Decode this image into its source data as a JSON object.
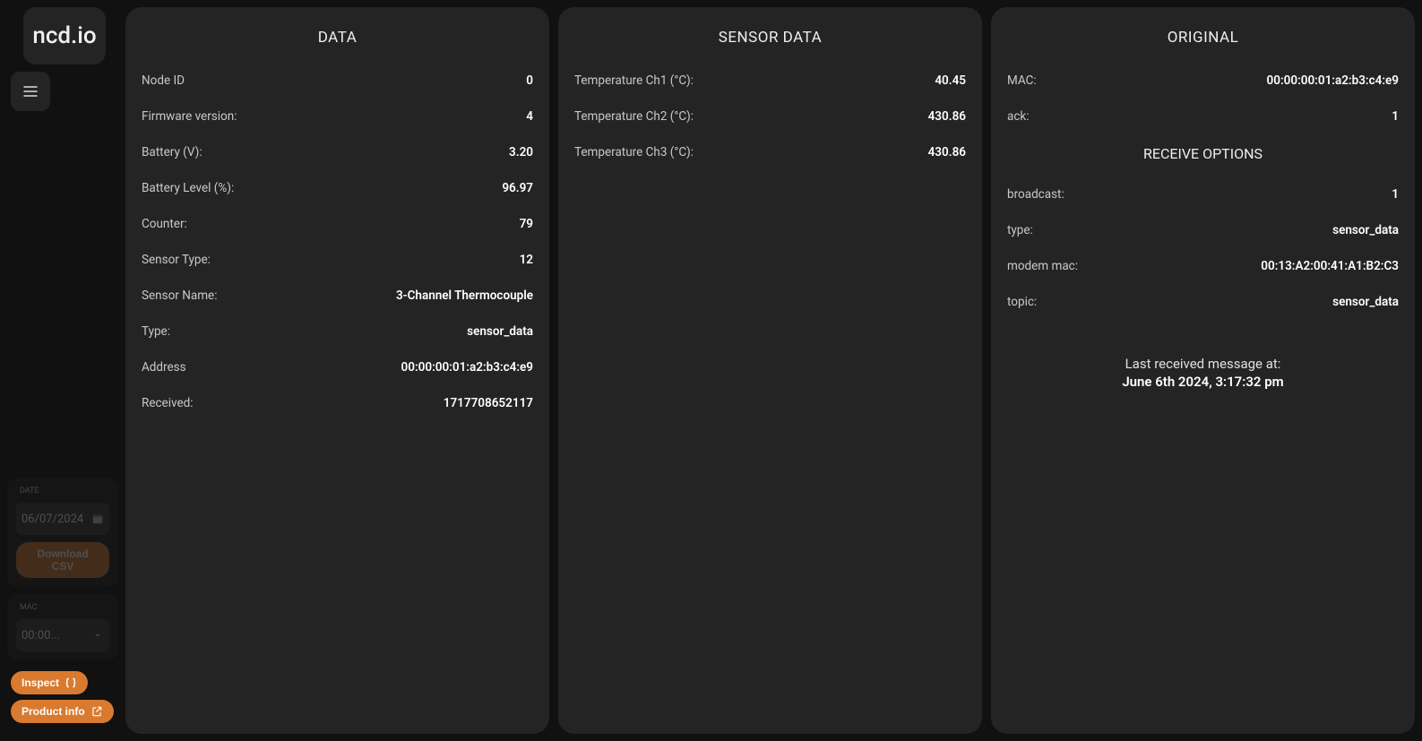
{
  "logo_text": "ncd.io",
  "sidebar": {
    "date_label": "Date",
    "date_value": "06/07/2024",
    "download_csv": "Download CSV",
    "mac_label": "MAC",
    "mac_value": "00:00...",
    "inspect_label": "Inspect",
    "product_info_label": "Product info"
  },
  "panels": {
    "data": {
      "title": "DATA",
      "rows": [
        {
          "label": "Node ID",
          "value": "0"
        },
        {
          "label": "Firmware version:",
          "value": "4"
        },
        {
          "label": "Battery (V):",
          "value": "3.20"
        },
        {
          "label": "Battery Level (%):",
          "value": "96.97"
        },
        {
          "label": "Counter:",
          "value": "79"
        },
        {
          "label": "Sensor Type:",
          "value": "12"
        },
        {
          "label": "Sensor Name:",
          "value": "3-Channel Thermocouple"
        },
        {
          "label": "Type:",
          "value": "sensor_data"
        },
        {
          "label": "Address",
          "value": "00:00:00:01:a2:b3:c4:e9"
        },
        {
          "label": "Received:",
          "value": "1717708652117"
        }
      ]
    },
    "sensor_data": {
      "title": "SENSOR DATA",
      "rows": [
        {
          "label": "Temperature Ch1 (°C):",
          "value": "40.45"
        },
        {
          "label": "Temperature Ch2 (°C):",
          "value": "430.86"
        },
        {
          "label": "Temperature Ch3 (°C):",
          "value": "430.86"
        }
      ]
    },
    "original": {
      "title": "ORIGINAL",
      "rows": [
        {
          "label": "MAC:",
          "value": "00:00:00:01:a2:b3:c4:e9"
        },
        {
          "label": "ack:",
          "value": "1"
        }
      ],
      "receive_title": "RECEIVE OPTIONS",
      "receive_rows": [
        {
          "label": "broadcast:",
          "value": "1"
        },
        {
          "label": "type:",
          "value": "sensor_data"
        },
        {
          "label": "modem mac:",
          "value": "00:13:A2:00:41:A1:B2:C3"
        },
        {
          "label": "topic:",
          "value": "sensor_data"
        }
      ],
      "last_msg_label": "Last received message at:",
      "last_msg_time": "June 6th 2024, 3:17:32 pm"
    }
  }
}
